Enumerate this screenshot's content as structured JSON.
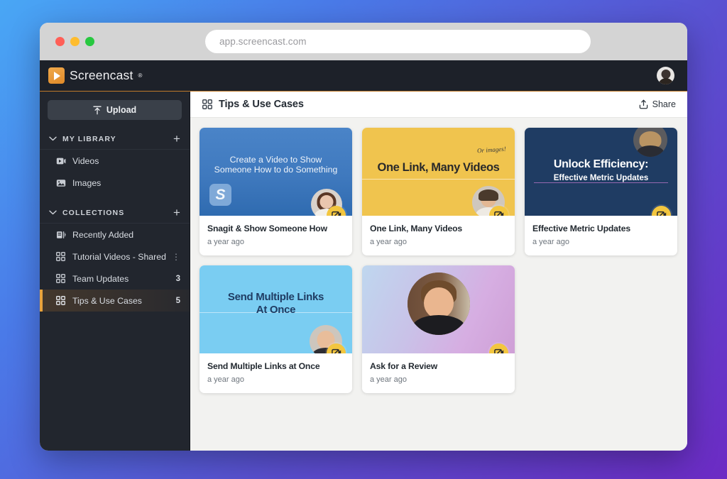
{
  "browser": {
    "url": "app.screencast.com",
    "traffic_lights": [
      "close-red",
      "minimize-yellow",
      "maximize-green"
    ]
  },
  "appbar": {
    "brand_name": "Screencast",
    "brand_registered": "®",
    "avatar_name": "user-avatar"
  },
  "sidebar": {
    "upload_label": "Upload",
    "sections": [
      {
        "key": "my_library",
        "title": "MY LIBRARY",
        "add_label": "+",
        "items": [
          {
            "label": "Videos",
            "icon": "video-icon",
            "count": "",
            "menu": ""
          },
          {
            "label": "Images",
            "icon": "image-icon",
            "count": "",
            "menu": ""
          }
        ]
      },
      {
        "key": "collections",
        "title": "COLLECTIONS",
        "add_label": "+",
        "items": [
          {
            "label": "Recently Added",
            "icon": "recent-icon",
            "count": "",
            "menu": ""
          },
          {
            "label": "Tutorial Videos - Shared",
            "icon": "collection-icon",
            "count": "",
            "menu": "⋮"
          },
          {
            "label": "Team Updates",
            "icon": "collection-icon",
            "count": "3",
            "menu": ""
          },
          {
            "label": "Tips & Use Cases",
            "icon": "collection-icon",
            "count": "5",
            "menu": "",
            "active": true
          }
        ]
      }
    ]
  },
  "main": {
    "title": "Tips & Use Cases",
    "title_icon": "collection-icon",
    "share_label": "Share",
    "share_icon": "share-upload-icon",
    "cards": [
      {
        "id": "snagit-show-someone-how",
        "thumb_title_line1": "Create a Video to Show",
        "thumb_title_line2": "Someone How to do Something",
        "snagit_mark": "S",
        "title": "Snagit & Show Someone How",
        "time": "a year ago",
        "badge_icon": "video-badge-icon",
        "thumb_bg": "#3f79be"
      },
      {
        "id": "one-link-many-videos",
        "thumb_title_line1": "One Link, Many Videos",
        "script_note": "Or images!",
        "title": "One Link, Many Videos",
        "time": "a year ago",
        "badge_icon": "video-badge-icon",
        "thumb_bg": "#f0c44e"
      },
      {
        "id": "effective-metric-updates",
        "thumb_title_line1": "Unlock Efficiency:",
        "thumb_title_line2": "Effective Metric Updates",
        "title": "Effective Metric Updates",
        "time": "a year ago",
        "badge_icon": "video-badge-icon",
        "thumb_bg": "#1f3c63"
      },
      {
        "id": "send-multiple-links-at-once",
        "thumb_title_line1": "Send Multiple Links",
        "thumb_title_line2": "At Once",
        "title": "Send Multiple Links at Once",
        "time": "a year ago",
        "badge_icon": "video-badge-icon",
        "thumb_bg": "#7acdf2"
      },
      {
        "id": "ask-for-a-review",
        "thumb_title_line1": "",
        "title": "Ask for a Review",
        "time": "a year ago",
        "badge_icon": "video-badge-icon",
        "thumb_bg": "#cf9fd6"
      }
    ]
  },
  "colors": {
    "brand_orange": "#e08a28",
    "sidebar_bg": "#22262e",
    "appbar_bg": "#1d2129",
    "accent_active": "#e8a33d",
    "badge_yellow": "#f3c63f",
    "page_bg": "#f2f2f0"
  }
}
